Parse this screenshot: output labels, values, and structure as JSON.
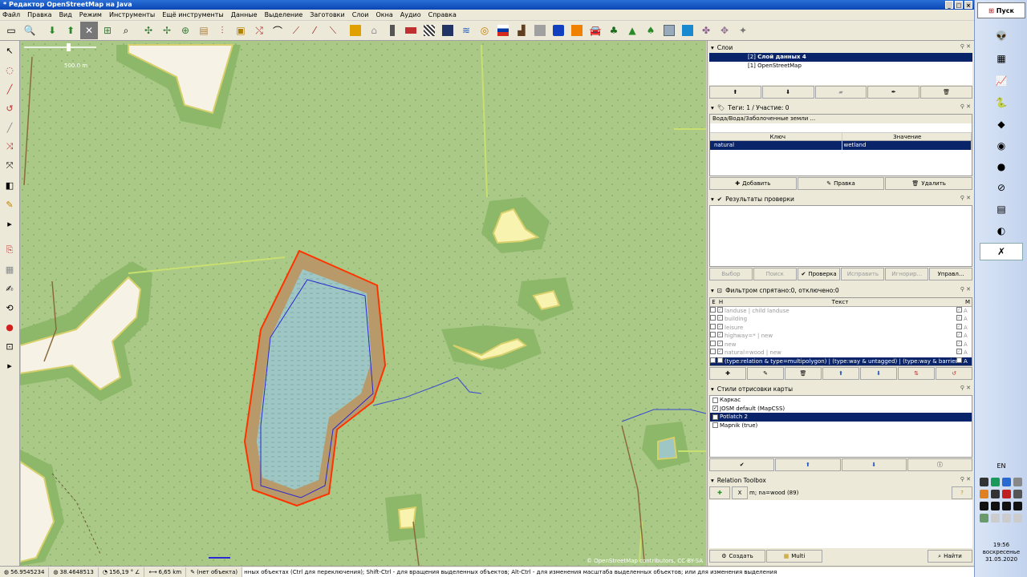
{
  "window": {
    "title": "* Редактор OpenStreetMap на Java"
  },
  "menu": [
    "Файл",
    "Правка",
    "Вид",
    "Режим",
    "Инструменты",
    "Ещё инструменты",
    "Данные",
    "Выделение",
    "Заготовки",
    "Слои",
    "Окна",
    "Аудио",
    "Справка"
  ],
  "map": {
    "scale_label": "500.0 m",
    "attribution": "© OpenStreetMap contributors, CC-BY-SA"
  },
  "layers_panel": {
    "title": "Слои",
    "layers": [
      {
        "index": "[2]",
        "name": "Слой данных 4",
        "active": true
      },
      {
        "index": "[1]",
        "name": "OpenStreetMap",
        "active": false
      }
    ]
  },
  "tags_panel": {
    "title": "Теги: 1 / Участие: 0",
    "preset": "Вода/Вода/Заболоченные земли ...",
    "col_key": "Ключ",
    "col_value": "Значение",
    "rows": [
      {
        "key": "natural",
        "value": "wetland"
      }
    ],
    "buttons": {
      "add": "Добавить",
      "edit": "Правка",
      "delete": "Удалить"
    }
  },
  "validation_panel": {
    "title": "Результаты проверки",
    "buttons": {
      "select": "Выбор",
      "search": "Поиск",
      "check": "Проверка",
      "fix": "Исправить",
      "ignore": "Игнорир...",
      "manage": "Управл..."
    }
  },
  "filter_panel": {
    "title": "Фильтром спрятано:0, отключено:0",
    "col_e": "Е",
    "col_h": "Н",
    "col_text": "Текст",
    "col_m": "M",
    "rows": [
      {
        "text": "landuse | child landuse",
        "mode": "A"
      },
      {
        "text": "building",
        "mode": "A"
      },
      {
        "text": "leisure",
        "mode": "A"
      },
      {
        "text": "highway=* | new",
        "mode": "A"
      },
      {
        "text": "new",
        "mode": "A"
      },
      {
        "text": "natural=wood | new",
        "mode": "A"
      },
      {
        "text": "(type:relation & type=multipolygon) | (type:way & untagged) | (type:way & barrier)",
        "mode": "A"
      }
    ]
  },
  "styles_panel": {
    "title": "Стили отрисовки карты",
    "items": [
      {
        "name": "Каркас",
        "checked": false,
        "selected": false
      },
      {
        "name": "JOSM default (MapCSS)",
        "checked": true,
        "selected": false
      },
      {
        "name": "Potlatch 2",
        "checked": false,
        "selected": true
      },
      {
        "name": "Mapnik (true)",
        "checked": false,
        "selected": false
      }
    ]
  },
  "relation_panel": {
    "title": "Relation Toolbox",
    "filter_text": "m; na=wood (89)",
    "buttons": {
      "create": "Создать",
      "multi": "Multi",
      "find": "Найти"
    }
  },
  "status": {
    "lat": "56.9545234",
    "lon": "38.4648513",
    "heading": "156,19 °",
    "distance": "6,65 km",
    "object": "(нет объекта)",
    "help": "нных объектах (Ctrl для переключения); Shift-Ctrl - для вращения выделенных объектов; Alt-Ctrl - для изменения масштаба выделенных объектов; или для изменения выделения"
  },
  "taskbar": {
    "start": "Пуск",
    "lang": "EN",
    "time": "19:56",
    "day": "воскресенье",
    "date": "31.05.2020"
  },
  "colors": {
    "map_bg": "#aac986",
    "wood": "#8db86a",
    "wetland_outline": "#ff3300",
    "water": "#9ec6c4",
    "selection": "#0a246a"
  }
}
